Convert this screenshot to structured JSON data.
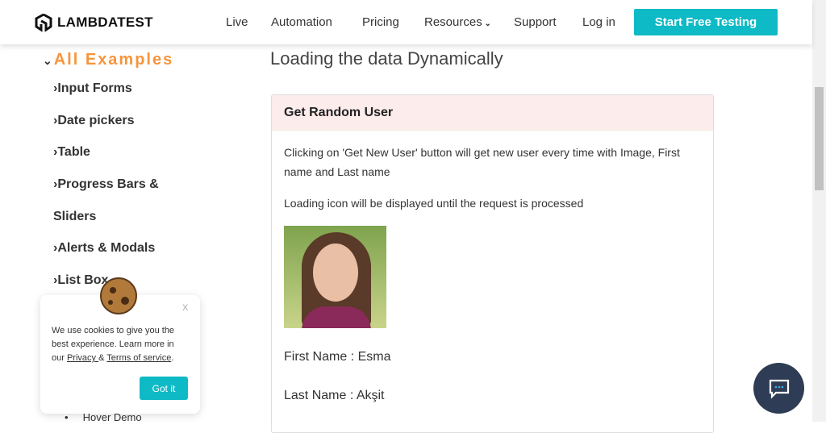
{
  "header": {
    "logo": "LAMBDATEST",
    "nav": [
      "Live",
      "Automation",
      "Pricing",
      "Resources",
      "Support",
      "Log in"
    ],
    "cta": "Start Free Testing"
  },
  "sidebar": {
    "title": "All Examples",
    "items": [
      "Input Forms",
      "Date pickers",
      "Table",
      "Progress Bars &",
      "Sliders",
      "Alerts & Modals",
      "List Box"
    ],
    "sub_item": "Hover Demo"
  },
  "main": {
    "title": "Loading the data Dynamically",
    "panel_title": "Get Random User",
    "desc": "Clicking on 'Get New User' button will get new user every time with Image, First name and Last name",
    "loading_note": "Loading icon will be displayed until the request is processed",
    "first_name": "First Name : Esma",
    "last_name": "Last Name : Akşit"
  },
  "cookie": {
    "close": "X",
    "text_pre": "We use cookies to give you the best experience. Learn more in our ",
    "privacy": "Privacy ",
    "amp": "& ",
    "terms": "Terms of service",
    "period": ".",
    "button": "Got it"
  }
}
